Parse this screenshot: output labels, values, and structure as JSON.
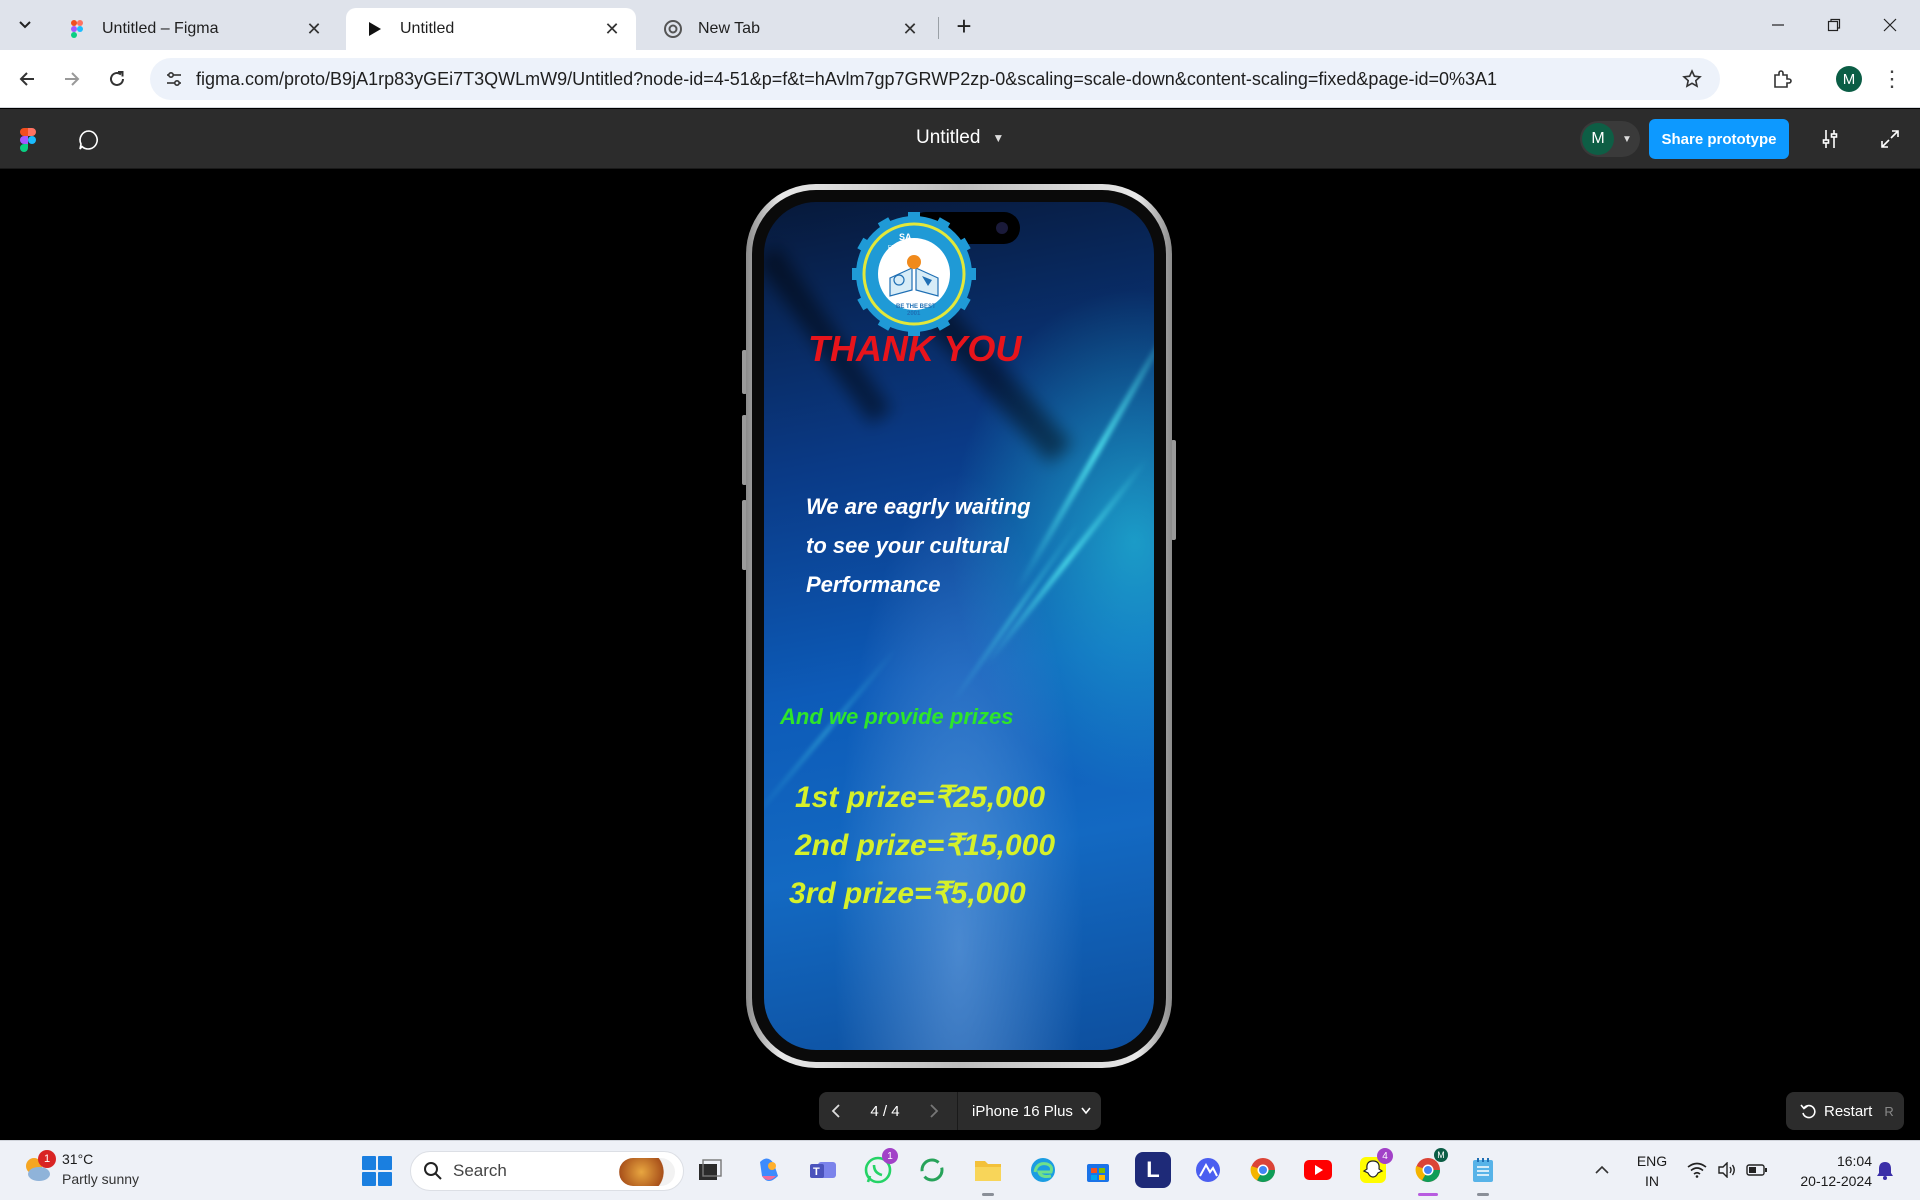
{
  "browser": {
    "tabs": [
      {
        "title": "Untitled – Figma",
        "favicon": "figma-icon",
        "active": false
      },
      {
        "title": "Untitled",
        "favicon": "play-icon",
        "active": true
      },
      {
        "title": "New Tab",
        "favicon": "chrome-icon",
        "active": false
      }
    ],
    "url": "figma.com/proto/B9jA1rp83yGEi7T3QWLmW9/Untitled?node-id=4-51&p=f&t=hAvlm7gp7GRWP2zp-0&scaling=scale-down&content-scaling=fixed&page-id=0%3A1",
    "profile_initial": "M"
  },
  "figma": {
    "file_title": "Untitled",
    "user_initial": "M",
    "share_label": "Share prototype"
  },
  "prototype": {
    "page_indicator": "4 / 4",
    "device": "iPhone 16 Plus",
    "restart_label": "Restart",
    "restart_shortcut": "R"
  },
  "screen": {
    "heading": "THANK YOU",
    "waiting_lines": [
      "We are eagrly waiting",
      "to see your  cultural",
      "Performance"
    ],
    "prizes_intro": "And we provide prizes",
    "prizes": [
      "1st prize=₹25,000",
      "2nd prize=₹15,000",
      "3rd prize=₹5,000"
    ],
    "logo_lines": [
      "SA",
      "ENGINEE",
      "BE THE BEST",
      "2001"
    ]
  },
  "taskbar": {
    "weather_temp": "31°C",
    "weather_condition": "Partly sunny",
    "weather_badge": "1",
    "search_placeholder": "Search",
    "whatsapp_badge": "1",
    "snapchat_badge": "4",
    "lang_line1": "ENG",
    "lang_line2": "IN",
    "time": "16:04",
    "date": "20-12-2024",
    "letter_app": "L",
    "chrome_profile": "M"
  },
  "colors": {
    "share_button": "#0d99ff",
    "heading": "#e8141b",
    "prizes_intro": "#2ee52a",
    "prizes": "#d6f12a"
  }
}
